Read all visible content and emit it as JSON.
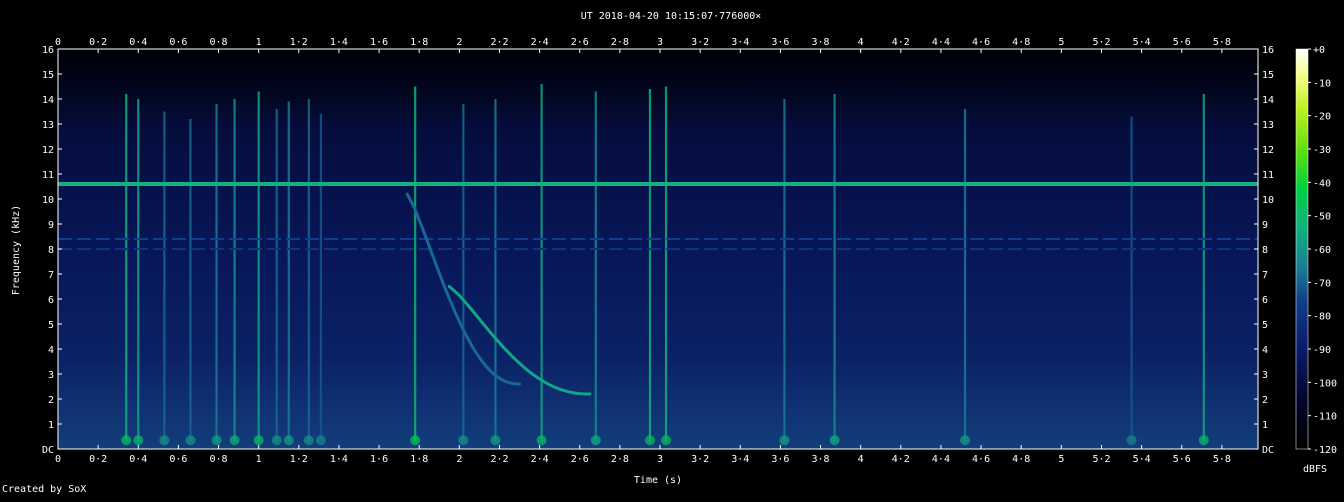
{
  "chart_data": {
    "type": "heatmap",
    "title": "UT 2018-04-20 10:15:07·776000×",
    "xlabel": "Time (s)",
    "ylabel": "Frequency (kHz)",
    "xlim": [
      0,
      5.98
    ],
    "ylim": [
      0,
      16
    ],
    "x_ticks": [
      "0",
      "0·2",
      "0·4",
      "0·6",
      "0·8",
      "1",
      "1·2",
      "1·4",
      "1·6",
      "1·8",
      "2",
      "2·2",
      "2·4",
      "2·6",
      "2·8",
      "3",
      "3·2",
      "3·4",
      "3·6",
      "3·8",
      "4",
      "4·2",
      "4·4",
      "4·6",
      "4·8",
      "5",
      "5·2",
      "5·4",
      "5·6",
      "5·8"
    ],
    "y_ticks": [
      "DC",
      "1",
      "2",
      "3",
      "4",
      "5",
      "6",
      "7",
      "8",
      "9",
      "10",
      "11",
      "12",
      "13",
      "14",
      "15",
      "16"
    ],
    "colorbar": {
      "label": "dBFS",
      "ticks": [
        "+0",
        "-10",
        "-20",
        "-30",
        "-40",
        "-50",
        "-60",
        "-70",
        "-80",
        "-90",
        "-100",
        "-110",
        "-120"
      ],
      "range": [
        -120,
        0
      ]
    },
    "background_level_dbfs": -95,
    "steady_tones": [
      {
        "freq_khz": 10.6,
        "level_dbfs": -70
      },
      {
        "freq_khz": 8.4,
        "level_dbfs": -85,
        "dashed": true
      },
      {
        "freq_khz": 8.0,
        "level_dbfs": -88,
        "dashed": true
      }
    ],
    "whistler_traces": [
      {
        "start_time_s": 1.74,
        "start_freq_khz": 10.2,
        "end_time_s": 2.3,
        "end_freq_khz": 2.6,
        "level_dbfs": -80
      },
      {
        "start_time_s": 1.95,
        "start_freq_khz": 6.5,
        "end_time_s": 2.65,
        "end_freq_khz": 2.2,
        "level_dbfs": -72
      }
    ],
    "impulses": [
      {
        "time_s": 0.34,
        "top_khz": 14.2,
        "level_dbfs": -70
      },
      {
        "time_s": 0.4,
        "top_khz": 14.0,
        "level_dbfs": -72
      },
      {
        "time_s": 0.53,
        "top_khz": 13.5,
        "level_dbfs": -80
      },
      {
        "time_s": 0.66,
        "top_khz": 13.2,
        "level_dbfs": -80
      },
      {
        "time_s": 0.79,
        "top_khz": 13.8,
        "level_dbfs": -78
      },
      {
        "time_s": 0.88,
        "top_khz": 14.0,
        "level_dbfs": -75
      },
      {
        "time_s": 1.0,
        "top_khz": 14.3,
        "level_dbfs": -72
      },
      {
        "time_s": 1.09,
        "top_khz": 13.6,
        "level_dbfs": -80
      },
      {
        "time_s": 1.15,
        "top_khz": 13.9,
        "level_dbfs": -78
      },
      {
        "time_s": 1.25,
        "top_khz": 14.0,
        "level_dbfs": -80
      },
      {
        "time_s": 1.31,
        "top_khz": 13.4,
        "level_dbfs": -82
      },
      {
        "time_s": 1.78,
        "top_khz": 14.5,
        "level_dbfs": -68
      },
      {
        "time_s": 2.02,
        "top_khz": 13.8,
        "level_dbfs": -80
      },
      {
        "time_s": 2.18,
        "top_khz": 14.0,
        "level_dbfs": -78
      },
      {
        "time_s": 2.41,
        "top_khz": 14.6,
        "level_dbfs": -72
      },
      {
        "time_s": 2.68,
        "top_khz": 14.3,
        "level_dbfs": -76
      },
      {
        "time_s": 2.95,
        "top_khz": 14.4,
        "level_dbfs": -70
      },
      {
        "time_s": 3.03,
        "top_khz": 14.5,
        "level_dbfs": -70
      },
      {
        "time_s": 3.62,
        "top_khz": 14.0,
        "level_dbfs": -78
      },
      {
        "time_s": 3.87,
        "top_khz": 14.2,
        "level_dbfs": -76
      },
      {
        "time_s": 4.52,
        "top_khz": 13.6,
        "level_dbfs": -78
      },
      {
        "time_s": 5.35,
        "top_khz": 13.3,
        "level_dbfs": -82
      },
      {
        "time_s": 5.71,
        "top_khz": 14.2,
        "level_dbfs": -72
      }
    ],
    "credit": "Created by SoX"
  }
}
